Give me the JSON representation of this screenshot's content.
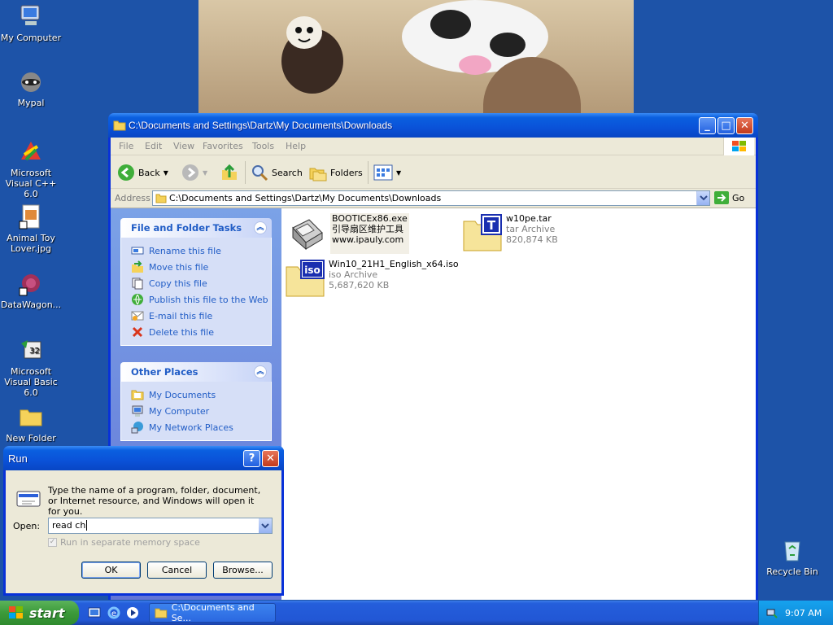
{
  "desktop": {
    "icons": [
      {
        "label": "My Computer"
      },
      {
        "label": "Mypal"
      },
      {
        "label": "Microsoft Visual C++ 6.0"
      },
      {
        "label": "Animal Toy Lover.jpg"
      },
      {
        "label": "DataWagon..."
      },
      {
        "label": "Microsoft Visual Basic 6.0"
      },
      {
        "label": "New Folder"
      },
      {
        "label": "Recycle Bin"
      }
    ]
  },
  "explorer": {
    "title": "C:\\Documents and Settings\\Dartz\\My Documents\\Downloads",
    "menu": [
      "File",
      "Edit",
      "View",
      "Favorites",
      "Tools",
      "Help"
    ],
    "toolbar": {
      "back": "Back",
      "search": "Search",
      "folders": "Folders"
    },
    "address": {
      "label": "Address",
      "value": "C:\\Documents and Settings\\Dartz\\My Documents\\Downloads",
      "go": "Go"
    },
    "file_tasks": {
      "title": "File and Folder Tasks",
      "items": [
        "Rename this file",
        "Move this file",
        "Copy this file",
        "Publish this file to the Web",
        "E-mail this file",
        "Delete this file"
      ]
    },
    "other_places": {
      "title": "Other Places",
      "items": [
        "My Documents",
        "My Computer",
        "My Network Places"
      ]
    },
    "files": [
      {
        "name": "BOOTICEx86.exe",
        "line2": "引导扇区维护工具",
        "line3": "www.ipauly.com",
        "icon": "floppy-icon"
      },
      {
        "name": "w10pe.tar",
        "line2": "tar Archive",
        "line3": "820,874 KB",
        "icon": "tar-archive-icon"
      },
      {
        "name": "Win10_21H1_English_x64.iso",
        "line2": "iso Archive",
        "line3": "5,687,620 KB",
        "icon": "iso-archive-icon"
      }
    ]
  },
  "run_dialog": {
    "title": "Run",
    "help": "?",
    "description": "Type the name of a program, folder, document, or Internet resource, and Windows will open it for you.",
    "open_label": "Open:",
    "open_value": "read ch",
    "checkbox_label": "Run in separate memory space",
    "ok": "OK",
    "cancel": "Cancel",
    "browse": "Browse..."
  },
  "taskbar": {
    "start": "start",
    "task_label": "C:\\Documents and Se...",
    "clock": "9:07 AM"
  },
  "colors": {
    "xp_blue": "#0831d9",
    "task_link": "#215dc6",
    "desktop_bg": "#1d53a8"
  }
}
